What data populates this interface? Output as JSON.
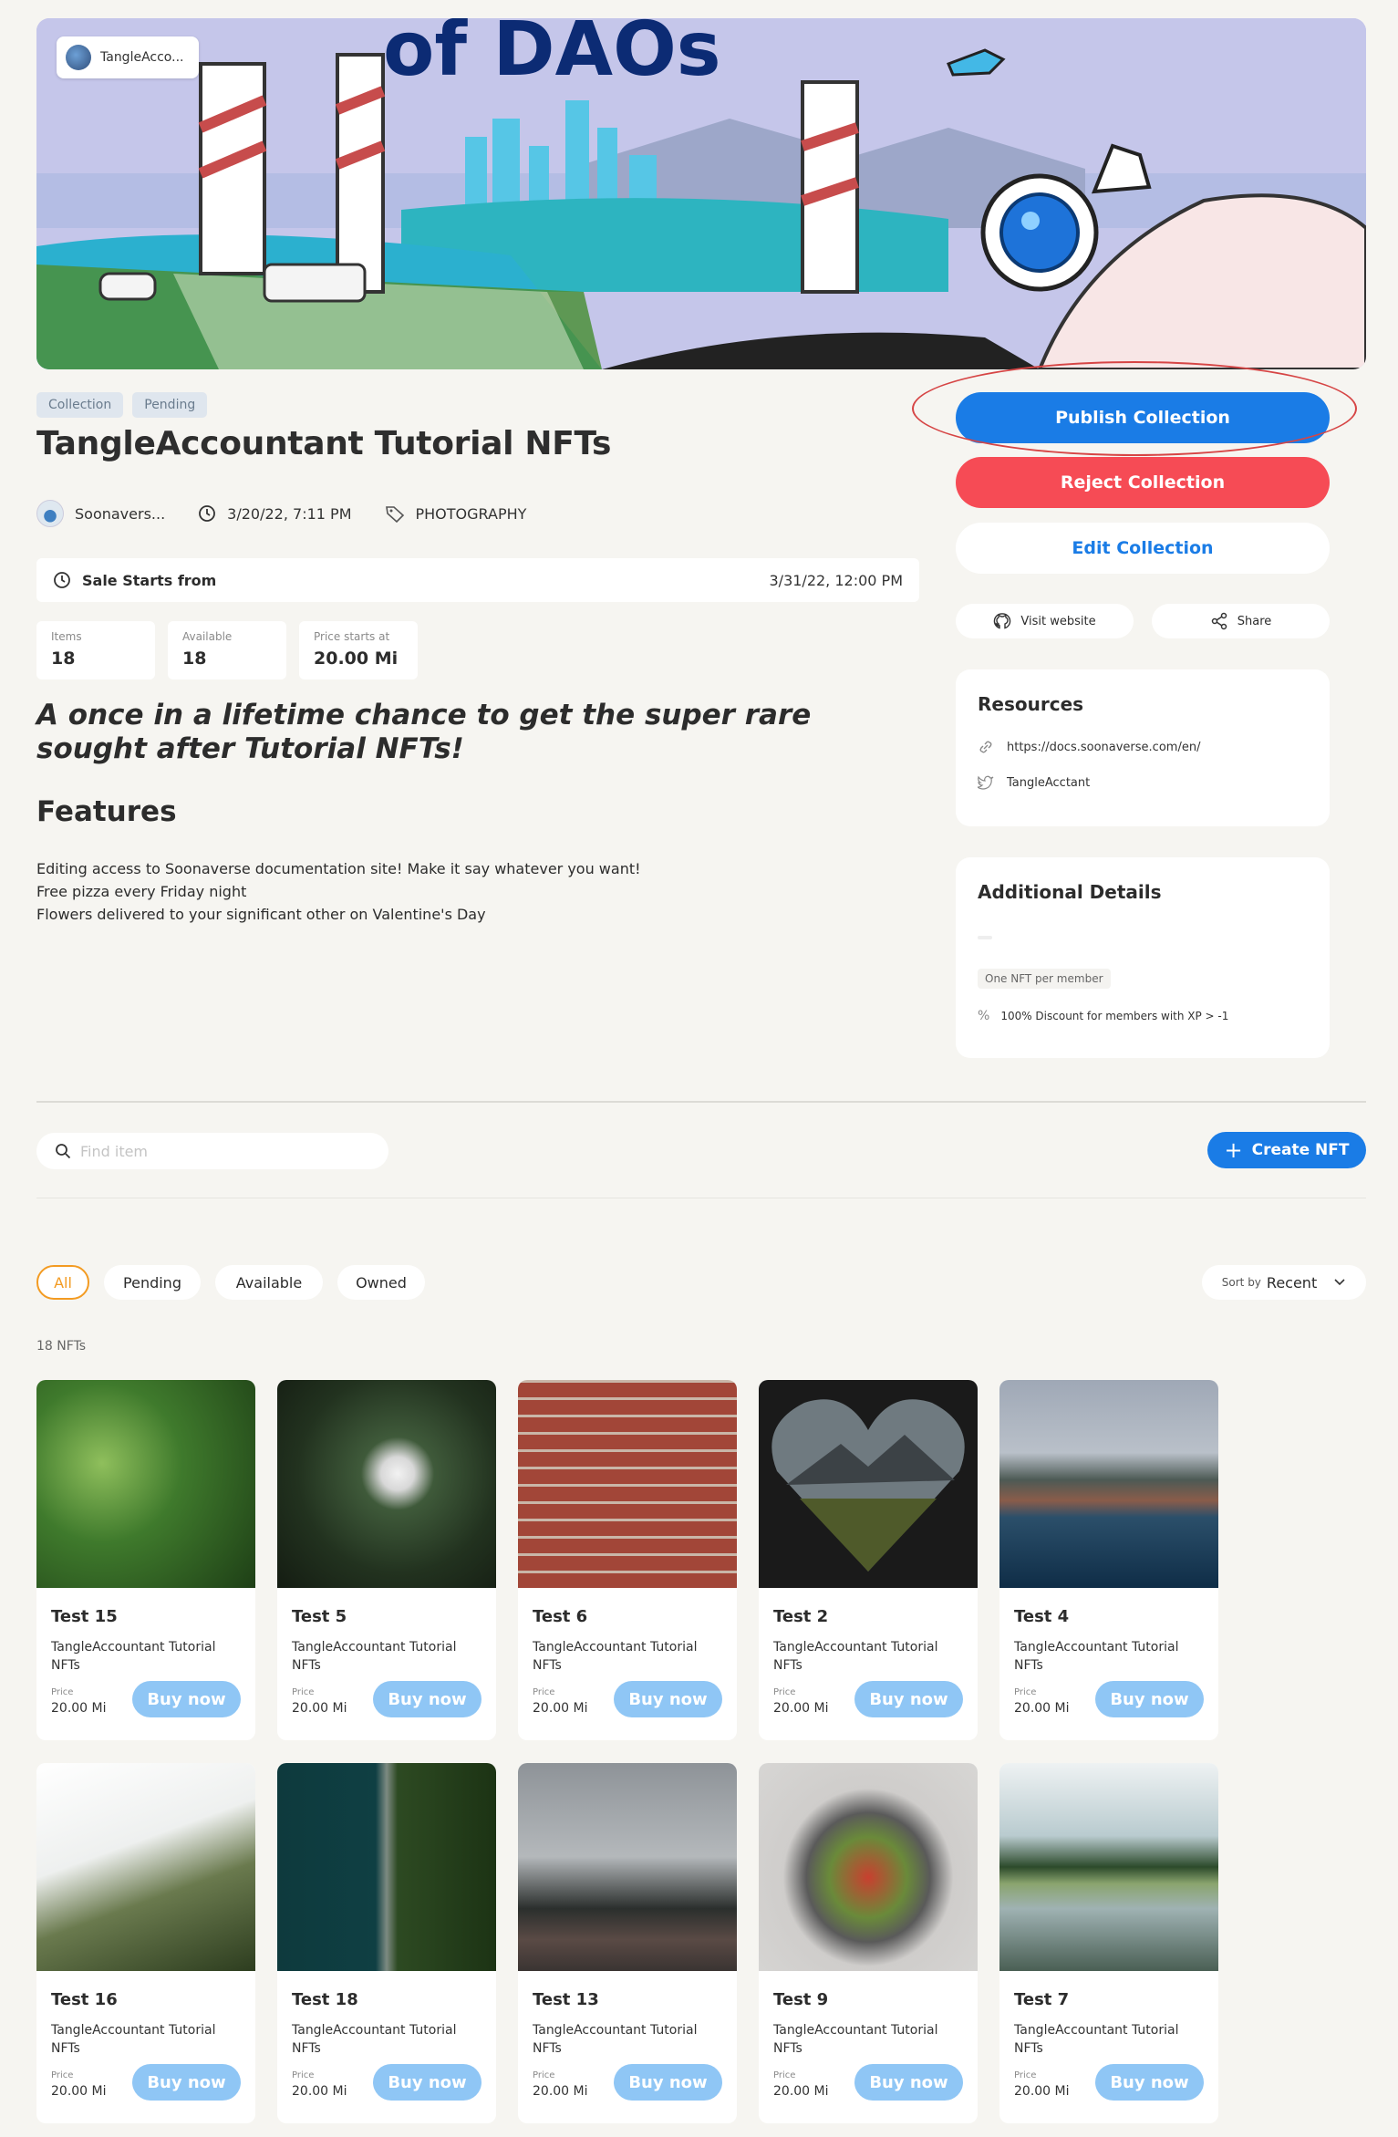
{
  "banner": {
    "owner": "TangleAcco...",
    "title_fragment": "of DAOs"
  },
  "collection": {
    "tags": [
      "Collection",
      "Pending"
    ],
    "title": "TangleAccountant Tutorial NFTs",
    "author": "Soonavers...",
    "date": "3/20/22, 7:11 PM",
    "category": "PHOTOGRAPHY",
    "sale_label": "Sale Starts from",
    "sale_date": "3/31/22, 12:00 PM",
    "stats": [
      {
        "label": "Items",
        "value": "18"
      },
      {
        "label": "Available",
        "value": "18"
      },
      {
        "label": "Price starts at",
        "value": "20.00 Mi"
      }
    ],
    "tagline": "A once in a lifetime chance to get the super rare sought after Tutorial NFTs!",
    "features_heading": "Features",
    "features": [
      "Editing access to Soonaverse documentation site! Make it say whatever you want!",
      "Free pizza every Friday night",
      "Flowers delivered to your significant other on Valentine's Day"
    ]
  },
  "actions": {
    "publish": "Publish Collection",
    "reject": "Reject Collection",
    "edit": "Edit Collection",
    "visit": "Visit website",
    "share": "Share"
  },
  "resources": {
    "heading": "Resources",
    "link": "https://docs.soonaverse.com/en/",
    "twitter": "TangleAcctant"
  },
  "additional": {
    "heading": "Additional Details",
    "pill": "One NFT per member",
    "discount": "100% Discount for members with XP > -1"
  },
  "toolbar": {
    "search_placeholder": "Find item",
    "create_label": "Create NFT",
    "filters": [
      "All",
      "Pending",
      "Available",
      "Owned"
    ],
    "sort_prefix": "Sort by",
    "sort_value": "Recent",
    "count": "18 NFTs"
  },
  "nfts": [
    {
      "name": "Test 15",
      "collection": "TangleAccountant Tutorial NFTs",
      "price_label": "Price",
      "price": "20.00 Mi",
      "buy": "Buy now"
    },
    {
      "name": "Test 5",
      "collection": "TangleAccountant Tutorial NFTs",
      "price_label": "Price",
      "price": "20.00 Mi",
      "buy": "Buy now"
    },
    {
      "name": "Test 6",
      "collection": "TangleAccountant Tutorial NFTs",
      "price_label": "Price",
      "price": "20.00 Mi",
      "buy": "Buy now"
    },
    {
      "name": "Test 2",
      "collection": "TangleAccountant Tutorial NFTs",
      "price_label": "Price",
      "price": "20.00 Mi",
      "buy": "Buy now"
    },
    {
      "name": "Test 4",
      "collection": "TangleAccountant Tutorial NFTs",
      "price_label": "Price",
      "price": "20.00 Mi",
      "buy": "Buy now"
    },
    {
      "name": "Test 16",
      "collection": "TangleAccountant Tutorial NFTs",
      "price_label": "Price",
      "price": "20.00 Mi",
      "buy": "Buy now"
    },
    {
      "name": "Test 18",
      "collection": "TangleAccountant Tutorial NFTs",
      "price_label": "Price",
      "price": "20.00 Mi",
      "buy": "Buy now"
    },
    {
      "name": "Test 13",
      "collection": "TangleAccountant Tutorial NFTs",
      "price_label": "Price",
      "price": "20.00 Mi",
      "buy": "Buy now"
    },
    {
      "name": "Test 9",
      "collection": "TangleAccountant Tutorial NFTs",
      "price_label": "Price",
      "price": "20.00 Mi",
      "buy": "Buy now"
    },
    {
      "name": "Test 7",
      "collection": "TangleAccountant Tutorial NFTs",
      "price_label": "Price",
      "price": "20.00 Mi",
      "buy": "Buy now"
    }
  ],
  "colors": {
    "accent": "#1a7ce6",
    "danger": "#f64b55",
    "active_filter": "#f39b22",
    "buy_button": "#8fc6f5"
  }
}
